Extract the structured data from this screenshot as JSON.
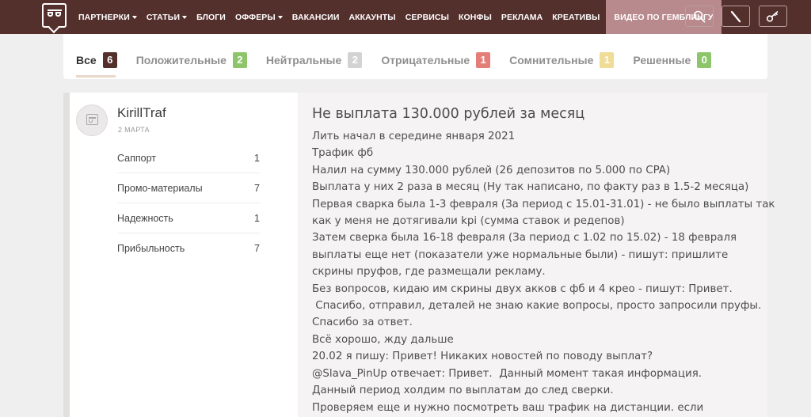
{
  "nav": {
    "items": [
      {
        "label": "ПАРТНЕРКИ",
        "dropdown": true
      },
      {
        "label": "СТАТЬИ",
        "dropdown": true
      },
      {
        "label": "БЛОГИ",
        "dropdown": false
      },
      {
        "label": "ОФФЕРЫ",
        "dropdown": true
      },
      {
        "label": "ВАКАНСИИ",
        "dropdown": false
      },
      {
        "label": "АККАУНТЫ",
        "dropdown": false
      },
      {
        "label": "СЕРВИСЫ",
        "dropdown": false
      },
      {
        "label": "КОНФЫ",
        "dropdown": false
      },
      {
        "label": "РЕКЛАМА",
        "dropdown": false
      },
      {
        "label": "КРЕАТИВЫ",
        "dropdown": false
      }
    ],
    "highlight": "ВИДЕО ПО ГЕМБЛИНГУ",
    "icons": [
      "search-icon",
      "pen-icon",
      "key-icon"
    ],
    "colors": {
      "bar": "#54302d",
      "highlight": "#b88a8d"
    }
  },
  "tabs": [
    {
      "label": "Все",
      "count": "6",
      "color": "#54302d",
      "active": true
    },
    {
      "label": "Положительные",
      "count": "2",
      "color": "#8dc56b",
      "active": false
    },
    {
      "label": "Нейтральные",
      "count": "2",
      "color": "#d3d3d3",
      "active": false
    },
    {
      "label": "Отрицательные",
      "count": "1",
      "color": "#e57e79",
      "active": false
    },
    {
      "label": "Сомнительные",
      "count": "1",
      "color": "#efdc96",
      "active": false
    },
    {
      "label": "Решенные",
      "count": "0",
      "color": "#8dc56b",
      "active": false
    }
  ],
  "review": {
    "author": "KirillTraf",
    "date": "2 МАРТА",
    "ratings": [
      {
        "label": "Саппорт",
        "value": "1"
      },
      {
        "label": "Промо-материалы",
        "value": "7"
      },
      {
        "label": "Надежность",
        "value": "1"
      },
      {
        "label": "Прибыльность",
        "value": "7"
      }
    ],
    "title": "Не выплата 130.000 рублей за месяц",
    "body": [
      "Лить начал в середине января 2021",
      "Трафик фб",
      "Налил на сумму 130.000 рублей (26 депозитов по 5.000 по CPA)",
      "Выплата у них 2 раза в месяц (Ну так написано, по факту раз в 1.5-2 месяца)",
      "Первая сварка была 1-3 февраля (За период с 15.01-31.01) - не было выплаты так",
      "как у меня не дотягивали kpi (сумма ставок и редепов)",
      "Затем сверка была 16-18 февраля (За период с 1.02 по 15.02) - 18 февраля",
      "выплаты еще нет (показатели уже нормальные были) - пишут: пришлите",
      "скрины пруфов, где размещали рекламу.",
      "Без вопросов, кидаю им скрины двух акков с фб и 4 крео - пишут: Привет.",
      " Спасибо, отправил, деталей не знаю какие вопросы, просто запросили пруфы.",
      "Спасибо за ответ.",
      "Всё хорошо, жду дальше",
      "20.02 я пишу: Привет! Никаких новостей по поводу выплат?",
      "@Slava_PinUp отвечает: Привет.  Данный момент такая информация.",
      "Данный период холдим по выплатам до след сверки.",
      "Проверяем еще и нужно посмотреть ваш трафик на дистанции. если"
    ]
  }
}
